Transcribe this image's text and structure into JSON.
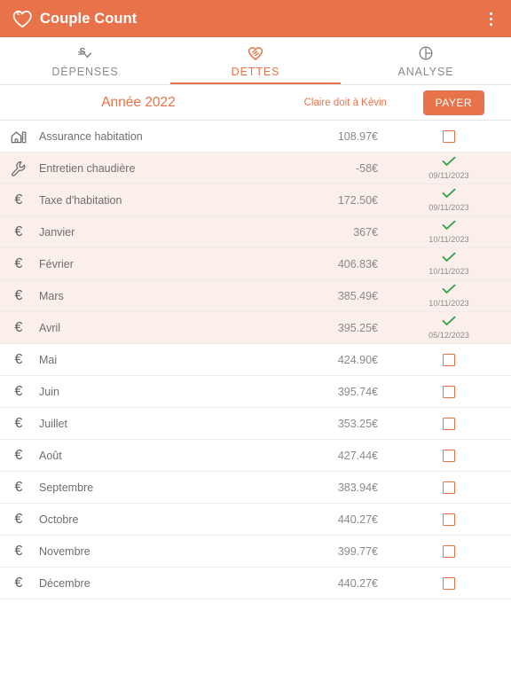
{
  "app": {
    "title": "Couple Count",
    "logo_icon": "euro-heart-icon",
    "overflow_icon": "more-vertical-icon",
    "accent_color": "#e8734a",
    "paid_row_color": "#fbefeb",
    "check_color": "#2f9e44"
  },
  "tabs": [
    {
      "label": "DÉPENSES",
      "icon": "currency-check-icon",
      "active": false
    },
    {
      "label": "DETTES",
      "icon": "handshake-icon",
      "active": true
    },
    {
      "label": "ANALYSE",
      "icon": "pie-chart-icon",
      "active": false
    }
  ],
  "summary": {
    "year": "Année 2022",
    "owes_text": "Claire doit à Kévin",
    "pay_button": "PAYER"
  },
  "rows": [
    {
      "icon": "house-icon",
      "label": "Assurance habitation",
      "amount": "108.97€",
      "paid": false,
      "date": ""
    },
    {
      "icon": "wrench-icon",
      "label": "Entretien chaudière",
      "amount": "-58€",
      "paid": true,
      "date": "09/11/2023"
    },
    {
      "icon": "euro-icon",
      "label": "Taxe d'habitation",
      "amount": "172.50€",
      "paid": true,
      "date": "09/11/2023"
    },
    {
      "icon": "euro-icon",
      "label": "Janvier",
      "amount": "367€",
      "paid": true,
      "date": "10/11/2023"
    },
    {
      "icon": "euro-icon",
      "label": "Février",
      "amount": "406.83€",
      "paid": true,
      "date": "10/11/2023"
    },
    {
      "icon": "euro-icon",
      "label": "Mars",
      "amount": "385.49€",
      "paid": true,
      "date": "10/11/2023"
    },
    {
      "icon": "euro-icon",
      "label": "Avril",
      "amount": "395.25€",
      "paid": true,
      "date": "05/12/2023"
    },
    {
      "icon": "euro-icon",
      "label": "Mai",
      "amount": "424.90€",
      "paid": false,
      "date": ""
    },
    {
      "icon": "euro-icon",
      "label": "Juin",
      "amount": "395.74€",
      "paid": false,
      "date": ""
    },
    {
      "icon": "euro-icon",
      "label": "Juillet",
      "amount": "353.25€",
      "paid": false,
      "date": ""
    },
    {
      "icon": "euro-icon",
      "label": "Août",
      "amount": "427.44€",
      "paid": false,
      "date": ""
    },
    {
      "icon": "euro-icon",
      "label": "Septembre",
      "amount": "383.94€",
      "paid": false,
      "date": ""
    },
    {
      "icon": "euro-icon",
      "label": "Octobre",
      "amount": "440.27€",
      "paid": false,
      "date": ""
    },
    {
      "icon": "euro-icon",
      "label": "Novembre",
      "amount": "399.77€",
      "paid": false,
      "date": ""
    },
    {
      "icon": "euro-icon",
      "label": "Décembre",
      "amount": "440.27€",
      "paid": false,
      "date": ""
    }
  ]
}
